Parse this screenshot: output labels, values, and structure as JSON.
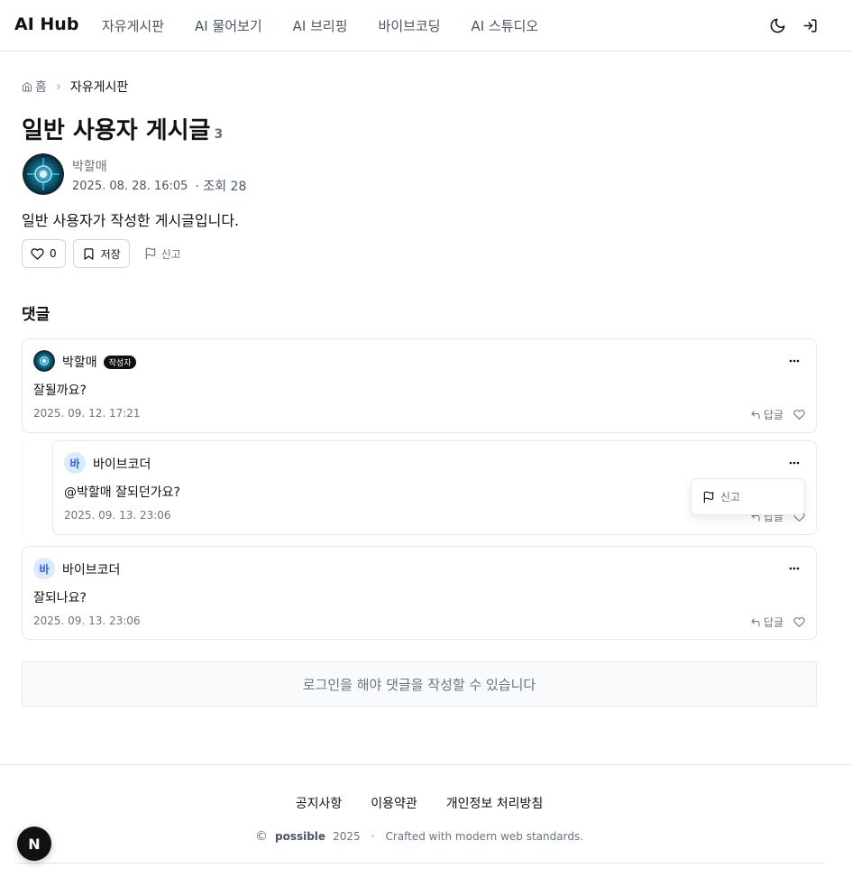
{
  "header": {
    "logo": "AI Hub",
    "nav": [
      "자유게시판",
      "AI 물어보기",
      "AI 브리핑",
      "바이브코딩",
      "AI 스튜디오"
    ],
    "icons": [
      "moon-icon",
      "login-icon"
    ]
  },
  "breadcrumb": {
    "home": "홈",
    "current": "자유게시판"
  },
  "post": {
    "title": "일반 사용자 게시글",
    "comment_count": "3",
    "author": "박할매",
    "date": "2025. 08. 28. 16:05",
    "views": "· 조회 28",
    "body": "일반 사용자가 작성한 게시글입니다.",
    "like_count": "0",
    "save_label": "저장",
    "report_label": "신고"
  },
  "comments_title": "댓글",
  "comments": [
    {
      "author": "박할매",
      "badge": "작성자",
      "text": "잘될까요?",
      "date": "2025. 09. 12. 17:21",
      "reply_label": "답글",
      "more": "···"
    },
    {
      "avatar_letter": "바",
      "author": "바이브코더",
      "text": "@박할매 잘되던가요?",
      "date": "2025. 09. 13. 23:06",
      "reply_label": "답글",
      "more": "···"
    },
    {
      "avatar_letter": "바",
      "author": "바이브코더",
      "text": "잘되나요?",
      "date": "2025. 09. 13. 23:06",
      "reply_label": "답글",
      "more": "···"
    }
  ],
  "dropdown": {
    "report_label": "신고"
  },
  "login_prompt": "로그인을 해야 댓글을 작성할 수 있습니다",
  "footer": {
    "links": [
      "공지사항",
      "이용약관",
      "개인정보 처리방침"
    ],
    "copy_symbol": "©",
    "brand": "possible",
    "year": "2025",
    "separator": "·",
    "tagline": "Crafted with modern web standards."
  },
  "floating_badge": "N"
}
